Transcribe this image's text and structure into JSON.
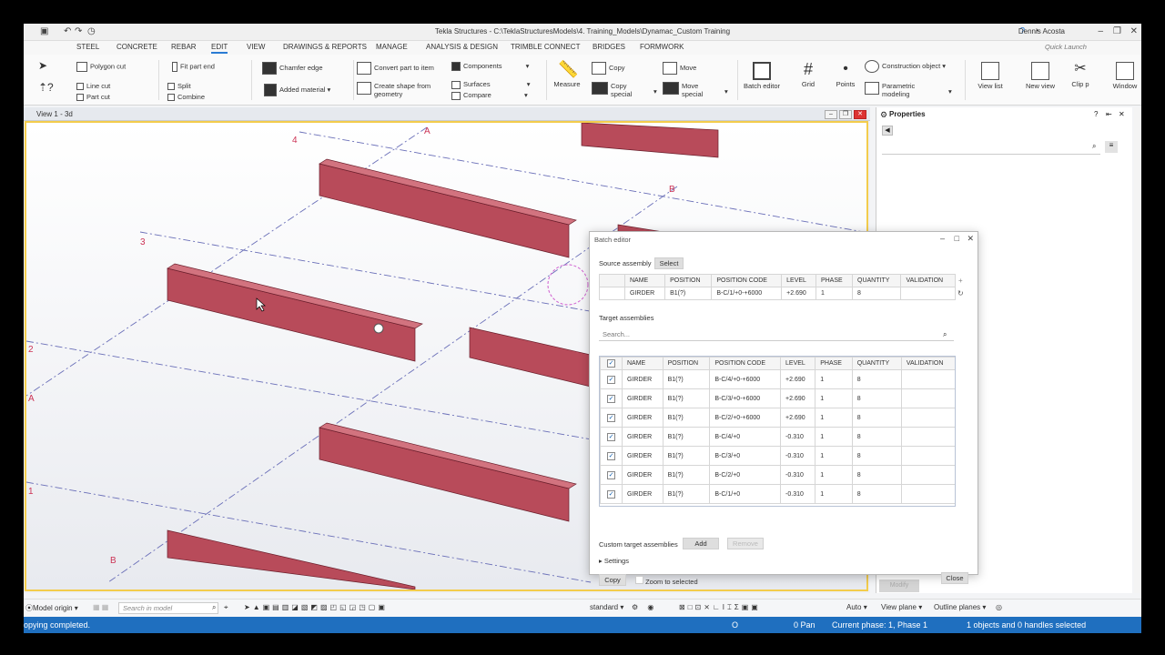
{
  "window": {
    "title": "Tekla Structures - C:\\TeklaStructuresModels\\4. Training_Models\\Dynamac_Custom Training",
    "user": "Dennis Acosta"
  },
  "menu": {
    "tabs": [
      "STEEL",
      "CONCRETE",
      "REBAR",
      "EDIT",
      "VIEW",
      "DRAWINGS & REPORTS",
      "MANAGE",
      "ANALYSIS & DESIGN",
      "TRIMBLE CONNECT",
      "BRIDGES",
      "FORMWORK"
    ],
    "active": "EDIT",
    "quick_launch": "Quick Launch"
  },
  "ribbon": {
    "polygon_cut": "Polygon cut",
    "line_cut": "Line cut",
    "part_cut": "Part cut",
    "fit_part_end": "Fit part end",
    "split": "Split",
    "combine": "Combine",
    "chamfer_edge": "Chamfer edge",
    "added_material": "Added material",
    "convert_part": "Convert part to item",
    "create_shape_1": "Create shape from",
    "create_shape_2": "geometry",
    "components": "Components",
    "surfaces": "Surfaces",
    "compare": "Compare",
    "measure": "Measure",
    "copy": "Copy",
    "copy_special_1": "Copy",
    "copy_special_2": "special",
    "move": "Move",
    "move_special_1": "Move",
    "move_special_2": "special",
    "batch_editor": "Batch editor",
    "grid": "Grid",
    "points": "Points",
    "construction_object": "Construction object",
    "parametric_1": "Parametric",
    "parametric_2": "modeling",
    "view_list": "View list",
    "new_view": "New view",
    "clip": "Clip p",
    "window": "Window"
  },
  "viewport": {
    "title": "View 1 - 3d"
  },
  "grid_labels": {
    "a_top": "A",
    "b_right": "B",
    "four": "4",
    "three": "3",
    "two": "2",
    "a_left": "A",
    "one": "1",
    "b_bottom": "B"
  },
  "properties": {
    "title": "Properties"
  },
  "batch_editor": {
    "title": "Batch editor",
    "source_label": "Source assembly",
    "select_button": "Select",
    "columns": [
      "NAME",
      "POSITION",
      "POSITION CODE",
      "LEVEL",
      "PHASE",
      "QUANTITY",
      "VALIDATION"
    ],
    "source_row": {
      "name": "GIRDER",
      "position": "B1(?)",
      "code": "B-C/1/+0-+6000",
      "level": "+2.690",
      "phase": "1",
      "quantity": "8",
      "validation": ""
    },
    "target_label": "Target assemblies",
    "search_placeholder": "Search...",
    "target_rows": [
      {
        "name": "GIRDER",
        "position": "B1(?)",
        "code": "B-C/4/+0-+6000",
        "level": "+2.690",
        "phase": "1",
        "quantity": "8",
        "validation": ""
      },
      {
        "name": "GIRDER",
        "position": "B1(?)",
        "code": "B-C/3/+0-+6000",
        "level": "+2.690",
        "phase": "1",
        "quantity": "8",
        "validation": ""
      },
      {
        "name": "GIRDER",
        "position": "B1(?)",
        "code": "B-C/2/+0-+6000",
        "level": "+2.690",
        "phase": "1",
        "quantity": "8",
        "validation": ""
      },
      {
        "name": "GIRDER",
        "position": "B1(?)",
        "code": "B-C/4/+0",
        "level": "-0.310",
        "phase": "1",
        "quantity": "8",
        "validation": ""
      },
      {
        "name": "GIRDER",
        "position": "B1(?)",
        "code": "B-C/3/+0",
        "level": "-0.310",
        "phase": "1",
        "quantity": "8",
        "validation": ""
      },
      {
        "name": "GIRDER",
        "position": "B1(?)",
        "code": "B-C/2/+0",
        "level": "-0.310",
        "phase": "1",
        "quantity": "8",
        "validation": ""
      },
      {
        "name": "GIRDER",
        "position": "B1(?)",
        "code": "B-C/1/+0",
        "level": "-0.310",
        "phase": "1",
        "quantity": "8",
        "validation": ""
      }
    ],
    "custom_label": "Custom target assemblies",
    "add_button": "Add",
    "remove_button": "Remove",
    "settings_label": "Settings",
    "copy_button": "Copy",
    "zoom_label": "Zoom to selected",
    "close_button": "Close"
  },
  "modify_button": "Modify",
  "toolstrip": {
    "model_origin": "Model origin",
    "search_placeholder": "Search in model",
    "standard": "standard",
    "auto": "Auto",
    "view_plane": "View plane",
    "outline_planes": "Outline planes"
  },
  "status": {
    "message": "opying completed.",
    "o": "O",
    "pan": "0 Pan",
    "phase": "Current phase: 1, Phase 1",
    "selection": "1 objects and 0 handles selected"
  },
  "colors": {
    "beam": "#b84b5a",
    "accent": "#2a7bd4",
    "status_bar": "#1f6fbf",
    "grid_line": "#5566aa"
  }
}
